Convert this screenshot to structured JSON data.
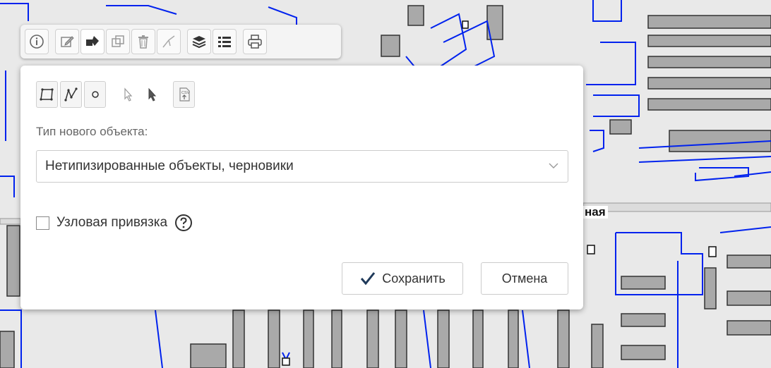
{
  "map": {
    "street_label": "ная",
    "colors": {
      "building_fill": "#a9a9a9",
      "building_stroke": "#333333",
      "parcel_line": "#0022ee",
      "background": "#e9e9e9"
    }
  },
  "toolbar": {
    "buttons": [
      {
        "icon": "info-icon"
      },
      {
        "icon": "edit-icon"
      },
      {
        "icon": "shapes-icon"
      },
      {
        "icon": "external-link-icon"
      },
      {
        "icon": "trash-icon"
      },
      {
        "icon": "measure-icon"
      },
      {
        "icon": "layers-icon"
      },
      {
        "icon": "list-icon"
      },
      {
        "icon": "print-icon"
      }
    ]
  },
  "panel": {
    "tools": [
      {
        "icon": "polygon-icon"
      },
      {
        "icon": "polyline-icon"
      },
      {
        "icon": "circle-icon"
      },
      {
        "icon": "select-arrow-icon"
      },
      {
        "icon": "pointer-icon"
      },
      {
        "icon": "csv-import-icon",
        "text": "CSV"
      }
    ],
    "type_label": "Тип нового объекта:",
    "type_value": "Нетипизированные объекты, черновики",
    "snap_label": "Узловая привязка",
    "snap_checked": false,
    "save_label": "Сохранить",
    "cancel_label": "Отмена"
  }
}
